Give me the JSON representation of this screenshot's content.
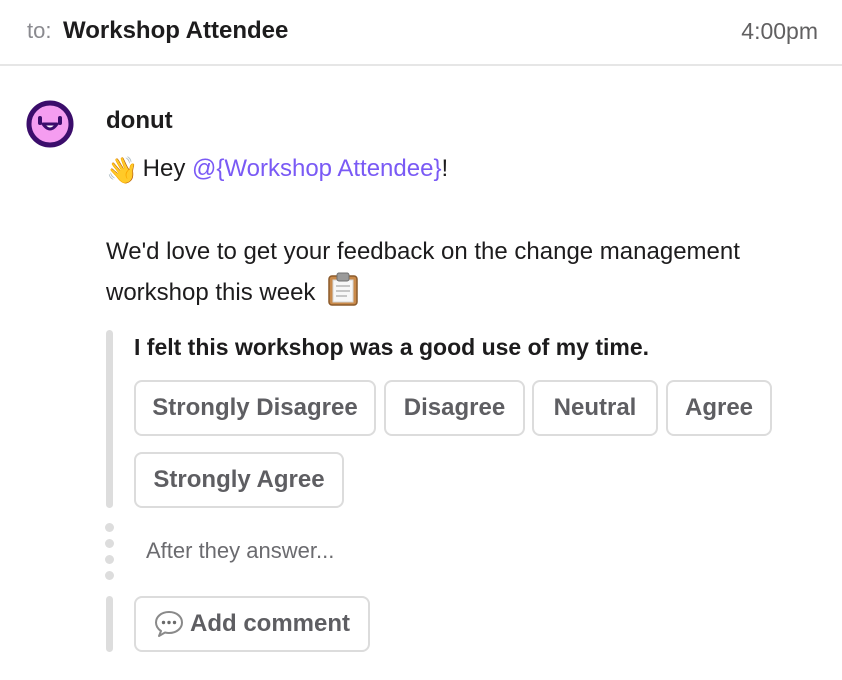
{
  "header": {
    "to_label": "to:",
    "recipient": "Workshop Attendee",
    "time": "4:00pm"
  },
  "message": {
    "sender": "donut",
    "avatar_icon": "donut-face-icon",
    "greeting_emoji_icon": "waving-hand-icon",
    "greeting_prefix": "Hey",
    "mention": "@{Workshop Attendee}",
    "greeting_suffix": "!",
    "paragraph": "We'd love to get your feedback on the change management workshop this week",
    "paragraph_emoji_icon": "clipboard-icon"
  },
  "survey": {
    "question": "I felt this workshop was a good use of my time.",
    "options": [
      "Strongly Disagree",
      "Disagree",
      "Neutral",
      "Agree",
      "Strongly Agree"
    ],
    "after_text": "After they answer...",
    "comment_button_label": "Add comment",
    "comment_icon": "speech-bubble-icon"
  },
  "colors": {
    "mention": "#7a5af5",
    "avatar_fill": "#f59df0",
    "avatar_stroke": "#3b0d6b",
    "button_border": "#dcdcdc",
    "rule": "#dddddd"
  }
}
